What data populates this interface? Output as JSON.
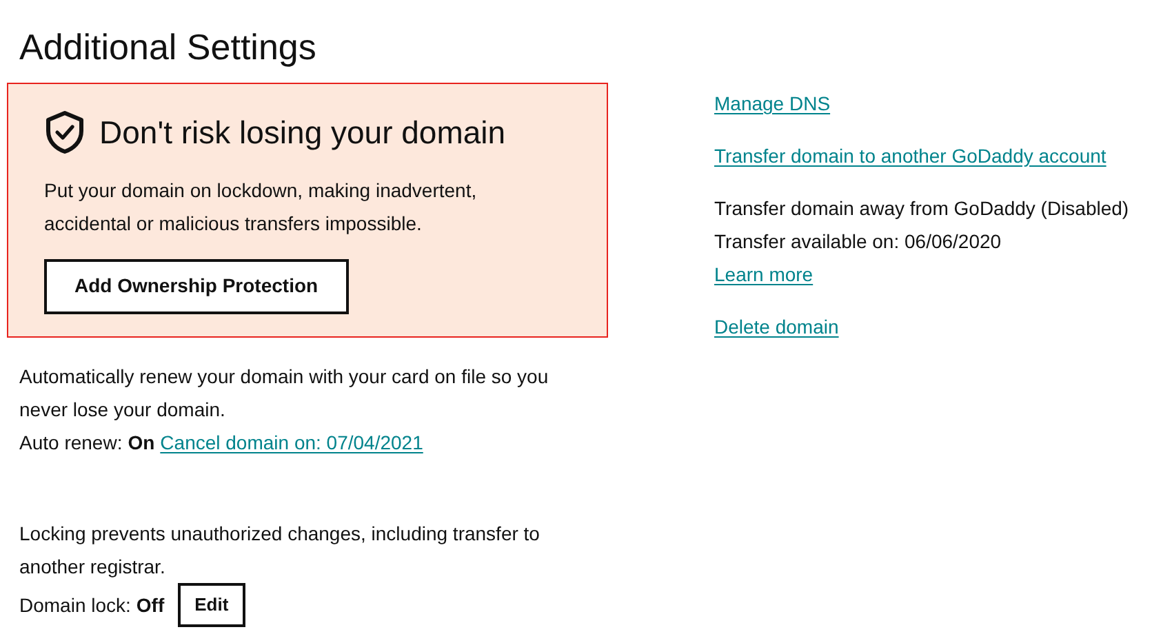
{
  "title": "Additional Settings",
  "promo": {
    "highlighted": true,
    "heading": "Don't risk losing your domain",
    "body": "Put your domain on lockdown, making inadvertent, accidental or malicious transfers impossible.",
    "button": "Add Ownership Protection"
  },
  "auto_renew": {
    "description": "Automatically renew your domain with your card on file so you never lose your domain.",
    "label": "Auto renew:",
    "value": "On",
    "link": "Cancel domain on: 07/04/2021"
  },
  "domain_lock": {
    "description": "Locking prevents unauthorized changes, including transfer to another registrar.",
    "label": "Domain lock:",
    "value": "Off",
    "button": "Edit"
  },
  "actions": [
    {
      "kind": "link",
      "text": "Manage DNS"
    },
    {
      "kind": "link",
      "text": "Transfer domain to another GoDaddy account"
    },
    {
      "kind": "status",
      "lines": [
        "Transfer domain away from GoDaddy (Disabled)",
        "Transfer available on: 06/06/2020"
      ],
      "link": "Learn more"
    },
    {
      "kind": "link",
      "text": "Delete domain"
    }
  ]
}
